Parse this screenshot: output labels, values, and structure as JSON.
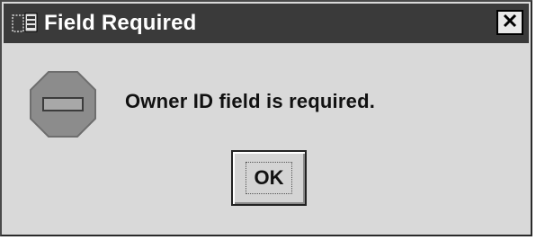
{
  "window": {
    "title": "Field Required",
    "icon": "application-window-icon",
    "close_icon": "close-icon",
    "title_bar_color": "#3a3a3a",
    "background_color": "#d9d9d9"
  },
  "message": {
    "icon": "stop-sign-icon",
    "text": "Owner ID field is required."
  },
  "buttons": {
    "ok_label": "OK"
  }
}
